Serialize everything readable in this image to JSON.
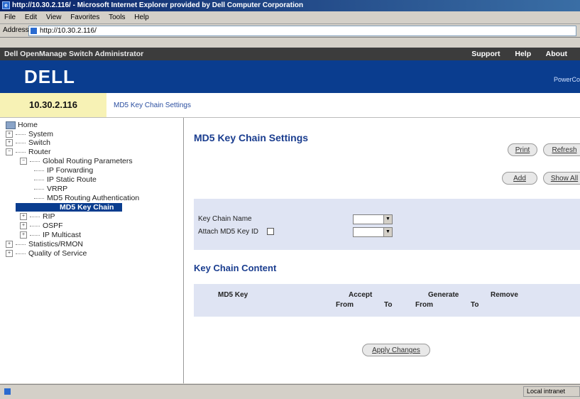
{
  "browser": {
    "title": "http://10.30.2.116/ - Microsoft Internet Explorer provided by Dell Computer Corporation",
    "menu": [
      "File",
      "Edit",
      "View",
      "Favorites",
      "Tools",
      "Help"
    ],
    "address_label": "Address",
    "address_value": "http://10.30.2.116/",
    "status_zone": "Local intranet"
  },
  "header": {
    "app_title": "Dell OpenManage Switch Administrator",
    "links": [
      "Support",
      "Help",
      "About"
    ],
    "logo": "DELL",
    "product": "PowerCo"
  },
  "location": {
    "ip": "10.30.2.116",
    "breadcrumb": "MD5 Key Chain Settings"
  },
  "tree": {
    "home": "Home",
    "system": "System",
    "switch": "Switch",
    "router": "Router",
    "global_routing": "Global Routing Parameters",
    "ip_forwarding": "IP Forwarding",
    "ip_static_route": "IP Static Route",
    "vrrp": "VRRP",
    "md5_auth": "MD5 Routing Authentication",
    "md5_key_chain": "MD5 Key Chain",
    "rip": "RIP",
    "ospf": "OSPF",
    "ip_multicast": "IP Multicast",
    "statistics": "Statistics/RMON",
    "qos": "Quality of Service"
  },
  "page": {
    "title": "MD5 Key Chain Settings",
    "print": "Print",
    "refresh": "Refresh",
    "add": "Add",
    "show_all": "Show All",
    "key_chain_name": "Key Chain Name",
    "attach_md5": "Attach MD5 Key ID",
    "content_title": "Key Chain Content",
    "apply": "Apply Changes"
  },
  "table": {
    "md5_key": "MD5 Key",
    "accept": "Accept",
    "generate": "Generate",
    "remove": "Remove",
    "from": "From",
    "to": "To"
  }
}
